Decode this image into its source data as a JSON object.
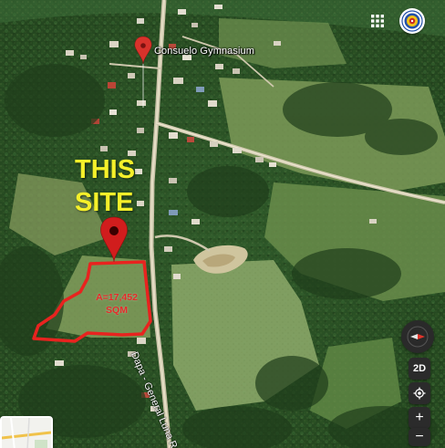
{
  "map": {
    "type": "satellite",
    "mode": "3D tilt"
  },
  "place_marker": {
    "icon": "location-pin-icon",
    "label": "Consuelo Gymnasium",
    "color": "#d8322b"
  },
  "road": {
    "name": "Dapa - General Luna Rd"
  },
  "annotation": {
    "heading_line1": "THIS",
    "heading_line2": "SITE",
    "heading_color": "#f5f02a",
    "pin_icon": "location-pin-icon",
    "pin_color": "#d11d1d",
    "area_line1": "A=17,452",
    "area_line2": "SQM",
    "boundary_color": "#e8231f"
  },
  "controls": {
    "apps_icon": "apps-grid-icon",
    "account_icon": "account-avatar-icon",
    "compass_icon": "compass-icon",
    "view_toggle_label": "2D",
    "locate_icon": "my-location-icon",
    "zoom_in_label": "+",
    "zoom_out_label": "−",
    "minimap_icon": "layers-thumbnail"
  }
}
